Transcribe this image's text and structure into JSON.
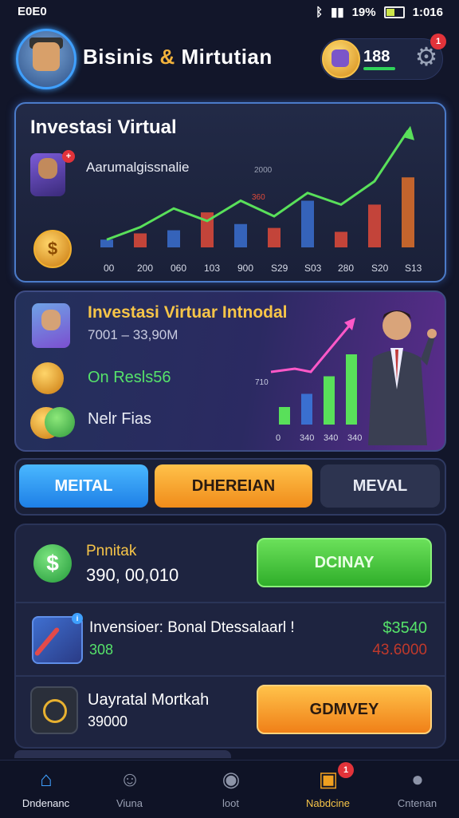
{
  "status": {
    "time": "E0E0",
    "battery": "19%",
    "clock": "1:016"
  },
  "header": {
    "title_part1": "Bisinis",
    "title_amp": "&",
    "title_part2": "Mirtutian",
    "coins": "188",
    "settings_badge": "1"
  },
  "card1": {
    "title": "Investasi Virtual",
    "label": "Aarumalgissnalie",
    "coin_symbol": "$",
    "chart_data": {
      "type": "bar",
      "categories": [
        "00",
        "200",
        "060",
        "103",
        "900",
        "S29",
        "S03",
        "280",
        "S20",
        "S13"
      ],
      "values": [
        10,
        18,
        22,
        45,
        30,
        25,
        60,
        20,
        55,
        90
      ],
      "series_line": [
        10,
        26,
        50,
        34,
        60,
        40,
        70,
        55,
        85,
        150
      ],
      "annotations": [
        "2000",
        "360"
      ]
    }
  },
  "card2": {
    "title": "Investasi Virtuar Intnodal",
    "subtitle": "7001 – 33,90M",
    "row1": "On Resls56",
    "row2": "Nelr Fias",
    "chart_data": {
      "type": "bar",
      "categories": [
        "0",
        "340",
        "340",
        "340"
      ],
      "values": [
        20,
        35,
        55,
        80
      ],
      "y_label_top": "710"
    }
  },
  "tabs": {
    "tab1": "MEITAL",
    "tab2": "DHEREIAN",
    "tab3": "MEVAL"
  },
  "panel": {
    "row1": {
      "label": "Pnnitak",
      "value": "390, 00,010",
      "button": "DCINAY"
    },
    "row2": {
      "label": "Invensioer: Bonal Dtessalaarl !",
      "sub": "308",
      "value1": "$3540",
      "value2": "43.6000"
    },
    "row3": {
      "label": "Uayratal Mortkah",
      "sub": "39000",
      "button": "GDMVEY"
    }
  },
  "nav": {
    "items": [
      {
        "label": "Dndenanc"
      },
      {
        "label": "Viuna"
      },
      {
        "label": "loot"
      },
      {
        "label": "Nabdcine",
        "badge": "1"
      },
      {
        "label": "Cntenan"
      }
    ]
  },
  "colors": {
    "accent_blue": "#3fa0ff",
    "accent_orange": "#f08c1a",
    "accent_green": "#2fae2a",
    "gold": "#f7c548"
  }
}
